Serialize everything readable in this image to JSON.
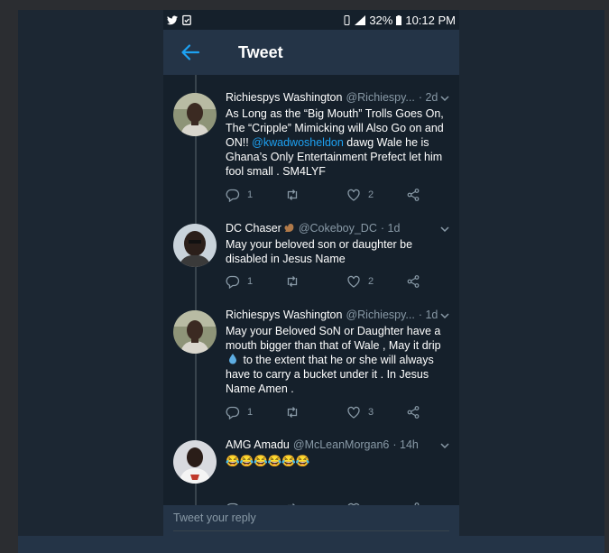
{
  "status_bar": {
    "battery": "32%",
    "time": "10:12 PM"
  },
  "header": {
    "title": "Tweet"
  },
  "tweets": [
    {
      "name": "Richiespys Washington",
      "handle": "@Richiespy...",
      "time": "· 2d",
      "body_before": "As Long as the “Big Mouth” Trolls Goes On, The “Cripple” Mimicking will Also Go on and ON!! ",
      "mention": "@kwadwosheldon",
      "body_after": " dawg Wale he is Ghana’s Only Entertainment Prefect let him fool small . SM4LYF",
      "replies": "1",
      "likes": "2"
    },
    {
      "name": "DC Chaser",
      "handle": "@Cokeboy_DC",
      "time": "· 1d",
      "body": "May your beloved son or daughter be disabled in Jesus Name",
      "replies": "1",
      "likes": "2"
    },
    {
      "name": "Richiespys Washington",
      "handle": "@Richiespy...",
      "time": "· 1d",
      "body_before": "May your Beloved SoN or Daughter have a mouth bigger than that of Wale , May it drip ",
      "body_after": " to the extent that he or she will always have to carry a bucket under it . In Jesus Name Amen .",
      "replies": "1",
      "likes": "3"
    },
    {
      "name": "AMG Amadu",
      "handle": "@McLeanMorgan6",
      "time": "· 14h",
      "body": "😂😂😂😂😂😂"
    }
  ],
  "reply_bar": {
    "placeholder": "Tweet your reply"
  },
  "colors": {
    "accent": "#1da1f2",
    "background": "#15202b",
    "header": "#243447",
    "muted": "#8899a6"
  }
}
